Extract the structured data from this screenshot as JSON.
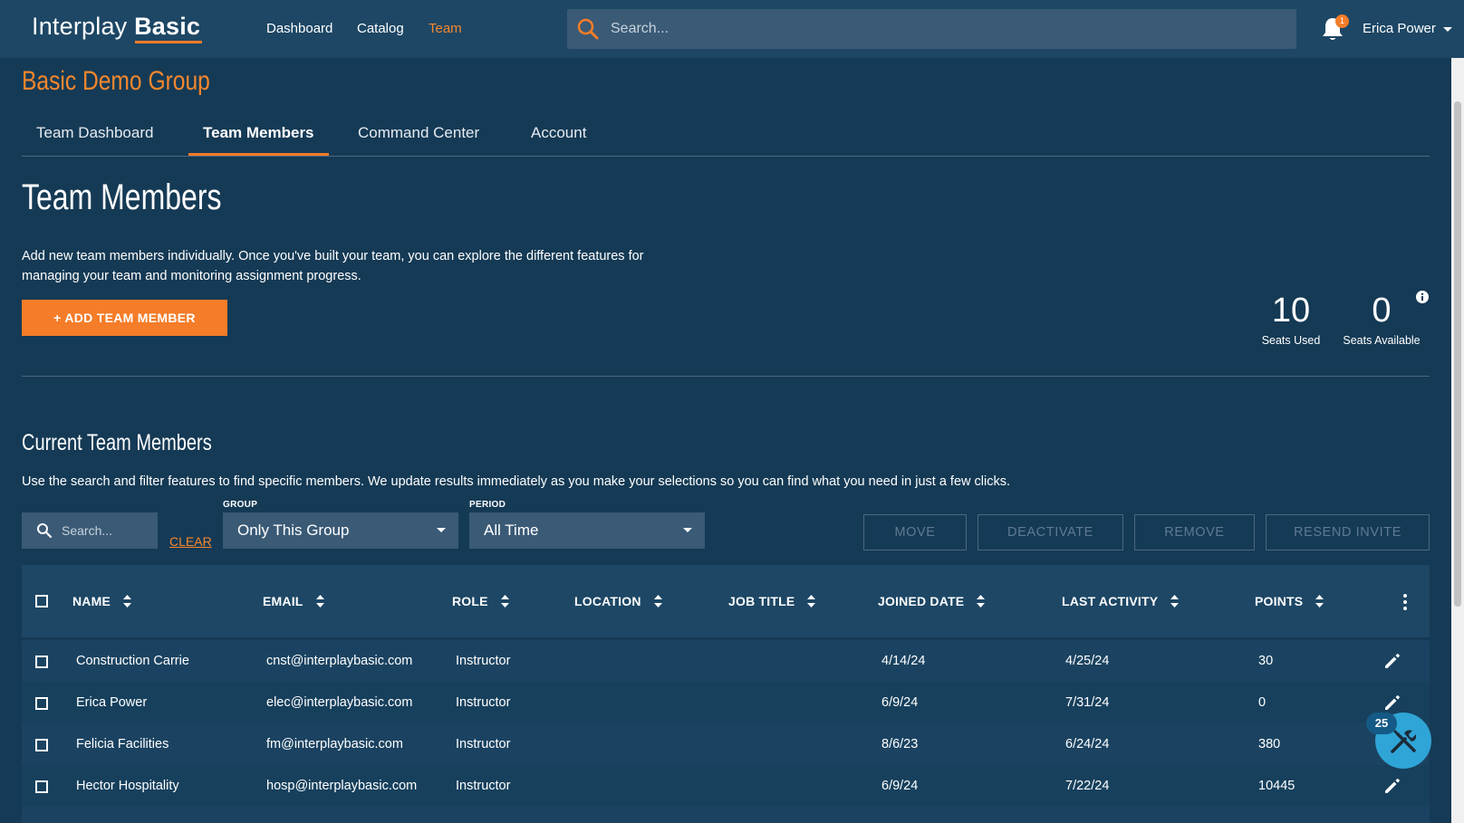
{
  "header": {
    "logo_light": "Interplay",
    "logo_bold": "Basic",
    "nav": [
      {
        "label": "Dashboard"
      },
      {
        "label": "Catalog"
      },
      {
        "label": "Team"
      }
    ],
    "search_placeholder": "Search...",
    "notification_count": "1",
    "user_name": "Erica Power"
  },
  "org_title": "Basic Demo Group",
  "tabs": [
    {
      "label": "Team Dashboard"
    },
    {
      "label": "Team Members"
    },
    {
      "label": "Command Center"
    },
    {
      "label": "Account"
    }
  ],
  "page": {
    "title": "Team Members",
    "intro": "Add new team members individually. Once you've built your team, you can explore the different features for managing your team and monitoring assignment progress.",
    "add_button": "+ ADD TEAM MEMBER"
  },
  "seats": {
    "used_value": "10",
    "used_label": "Seats Used",
    "available_value": "0",
    "available_label": "Seats Available"
  },
  "current": {
    "title": "Current Team Members",
    "description": "Use the search and filter features to find specific members. We update results immediately as you make your selections so you can find what you need in just a few clicks.",
    "search_placeholder": "Search...",
    "clear_label": "CLEAR",
    "group_label": "GROUP",
    "group_value": "Only This Group",
    "period_label": "PERIOD",
    "period_value": "All Time",
    "actions": [
      "MOVE",
      "DEACTIVATE",
      "REMOVE",
      "RESEND INVITE"
    ]
  },
  "table": {
    "columns": [
      "NAME",
      "EMAIL",
      "ROLE",
      "LOCATION",
      "JOB TITLE",
      "JOINED DATE",
      "LAST ACTIVITY",
      "POINTS"
    ],
    "rows": [
      {
        "name": "Construction Carrie",
        "email": "cnst@interplaybasic.com",
        "role": "Instructor",
        "location": "",
        "job_title": "",
        "joined": "4/14/24",
        "last_activity": "4/25/24",
        "points": "30"
      },
      {
        "name": "Erica Power",
        "email": "elec@interplaybasic.com",
        "role": "Instructor",
        "location": "",
        "job_title": "",
        "joined": "6/9/24",
        "last_activity": "7/31/24",
        "points": "0"
      },
      {
        "name": "Felicia Facilities",
        "email": "fm@interplaybasic.com",
        "role": "Instructor",
        "location": "",
        "job_title": "",
        "joined": "8/6/23",
        "last_activity": "6/24/24",
        "points": "380"
      },
      {
        "name": "Hector Hospitality",
        "email": "hosp@interplaybasic.com",
        "role": "Instructor",
        "location": "",
        "job_title": "",
        "joined": "6/9/24",
        "last_activity": "7/22/24",
        "points": "10445"
      }
    ]
  },
  "fab": {
    "badge": "25",
    "icon": "tools-icon"
  },
  "colors": {
    "accent": "#f57c28",
    "background": "#153a55",
    "header": "#1d4765",
    "field": "#3a5a76",
    "fab": "#2fa4d6"
  }
}
